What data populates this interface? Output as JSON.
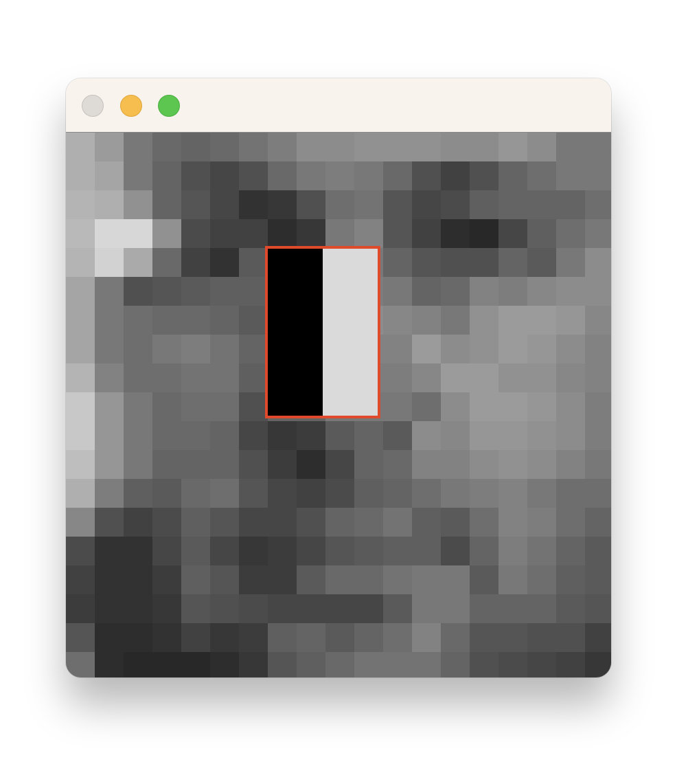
{
  "window": {
    "traffic_lights": [
      {
        "name": "close",
        "color": "#dedad6",
        "border": "#c5c1bd"
      },
      {
        "name": "minimize",
        "color": "#f5be4f",
        "border": "#e0a63a"
      },
      {
        "name": "zoom",
        "color": "#5cc651",
        "border": "#49ad3f"
      }
    ]
  },
  "image": {
    "grid": {
      "columns": 19,
      "rows": 19,
      "values": [
        [
          175,
          155,
          120,
          105,
          100,
          105,
          115,
          125,
          140,
          140,
          145,
          145,
          145,
          140,
          140,
          150,
          140,
          120,
          120
        ],
        [
          175,
          165,
          120,
          100,
          80,
          70,
          80,
          105,
          120,
          125,
          120,
          105,
          80,
          65,
          80,
          100,
          110,
          120,
          120
        ],
        [
          180,
          175,
          145,
          100,
          85,
          70,
          50,
          55,
          80,
          110,
          115,
          85,
          70,
          75,
          95,
          100,
          100,
          100,
          110
        ],
        [
          185,
          215,
          215,
          145,
          75,
          65,
          65,
          45,
          55,
          120,
          130,
          85,
          65,
          45,
          40,
          70,
          95,
          110,
          120
        ],
        [
          180,
          210,
          170,
          105,
          65,
          50,
          90,
          95,
          100,
          135,
          120,
          100,
          85,
          80,
          80,
          100,
          90,
          120,
          140
        ],
        [
          165,
          120,
          80,
          85,
          90,
          95,
          95,
          100,
          100,
          130,
          125,
          120,
          100,
          105,
          130,
          125,
          135,
          140,
          140
        ],
        [
          165,
          120,
          110,
          105,
          105,
          100,
          90,
          110,
          110,
          140,
          140,
          135,
          130,
          120,
          145,
          155,
          155,
          150,
          135
        ],
        [
          165,
          120,
          110,
          120,
          125,
          115,
          100,
          120,
          120,
          130,
          130,
          130,
          155,
          140,
          145,
          155,
          150,
          140,
          130
        ],
        [
          180,
          130,
          110,
          110,
          115,
          115,
          95,
          110,
          110,
          120,
          125,
          125,
          135,
          155,
          155,
          145,
          145,
          135,
          130
        ],
        [
          200,
          150,
          120,
          105,
          110,
          110,
          80,
          100,
          100,
          120,
          120,
          120,
          110,
          140,
          155,
          155,
          150,
          140,
          125
        ],
        [
          200,
          150,
          120,
          105,
          105,
          100,
          70,
          55,
          60,
          90,
          100,
          90,
          140,
          135,
          150,
          150,
          145,
          140,
          125
        ],
        [
          190,
          150,
          120,
          100,
          100,
          100,
          80,
          60,
          45,
          70,
          100,
          105,
          130,
          130,
          140,
          145,
          140,
          130,
          120
        ],
        [
          175,
          125,
          95,
          90,
          105,
          110,
          85,
          70,
          65,
          75,
          95,
          100,
          110,
          120,
          125,
          130,
          120,
          110,
          110
        ],
        [
          135,
          80,
          65,
          75,
          95,
          85,
          70,
          70,
          80,
          100,
          105,
          115,
          95,
          90,
          110,
          130,
          125,
          110,
          100
        ],
        [
          75,
          50,
          50,
          70,
          90,
          70,
          55,
          60,
          70,
          85,
          90,
          95,
          95,
          75,
          100,
          125,
          115,
          100,
          90
        ],
        [
          65,
          50,
          50,
          60,
          95,
          85,
          60,
          60,
          90,
          105,
          105,
          115,
          120,
          120,
          90,
          120,
          110,
          95,
          90
        ],
        [
          60,
          50,
          50,
          55,
          85,
          80,
          75,
          70,
          70,
          70,
          70,
          90,
          120,
          120,
          100,
          100,
          100,
          90,
          85
        ],
        [
          85,
          45,
          45,
          50,
          65,
          55,
          60,
          95,
          100,
          90,
          100,
          110,
          130,
          105,
          85,
          85,
          80,
          80,
          65
        ],
        [
          110,
          45,
          40,
          40,
          40,
          45,
          55,
          85,
          95,
          105,
          115,
          115,
          115,
          100,
          80,
          75,
          70,
          65,
          55
        ]
      ]
    },
    "highlight_patch": {
      "border_color": "#e04a2c",
      "left_value": 0,
      "right_value": 218
    }
  }
}
